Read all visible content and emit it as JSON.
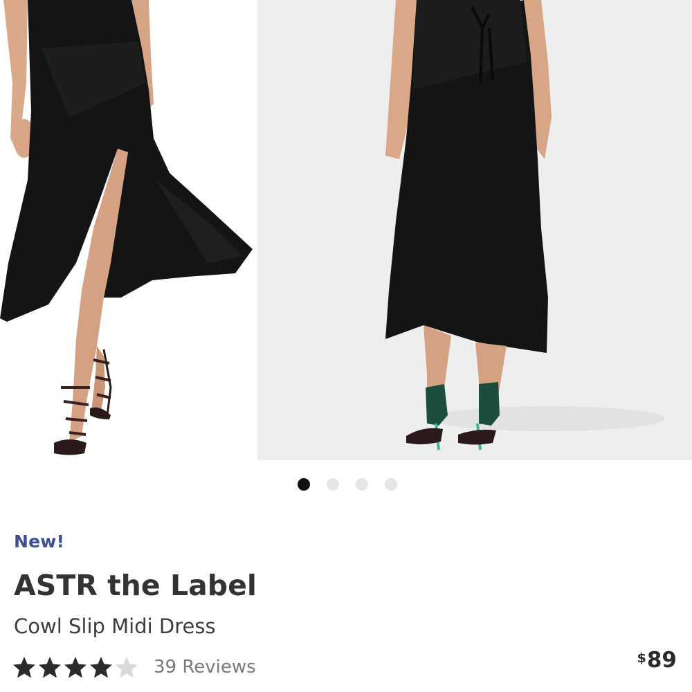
{
  "carousel": {
    "slides": [
      {
        "alt": "ASTR the Label Cowl Slip Midi Dress front view"
      },
      {
        "alt": "ASTR the Label Cowl Slip Midi Dress back view"
      },
      {
        "alt": "ASTR the Label Cowl Slip Midi Dress detail"
      }
    ],
    "dots_count": 4,
    "active_index": 0
  },
  "product": {
    "badge": "New!",
    "brand": "ASTR the Label",
    "name": "Cowl Slip Midi Dress",
    "rating": 4,
    "rating_max": 5,
    "reviews": "39 Reviews",
    "price_currency": "$",
    "price_value": "89"
  },
  "colors": {
    "badge": "#3e4f8e",
    "star_filled": "#2b2b2b",
    "star_empty": "#d9d9d9",
    "dot_active": "#111111",
    "dot_inactive": "#e5e5e5"
  }
}
